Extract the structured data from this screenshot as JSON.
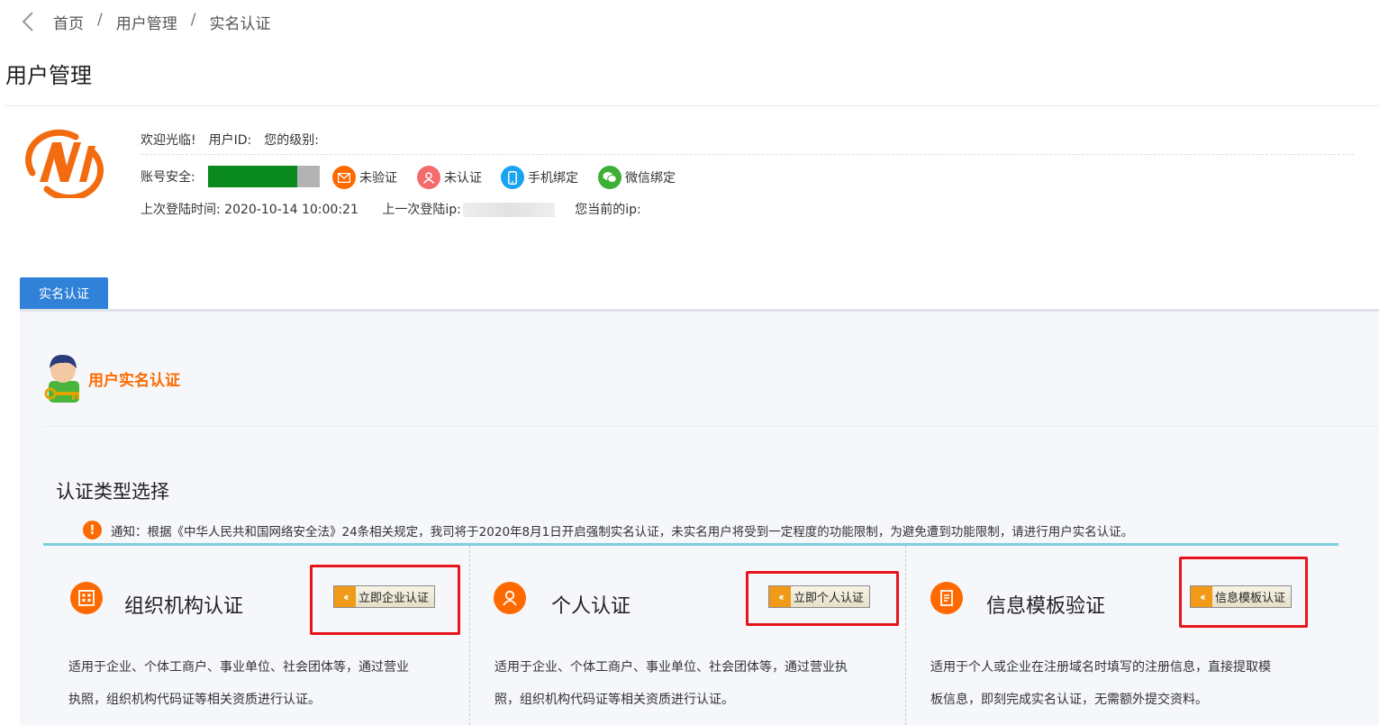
{
  "breadcrumb": [
    "首页",
    "用户管理",
    "实名认证"
  ],
  "page_title": "用户管理",
  "user": {
    "welcome": "欢迎光临!",
    "user_id_label": "用户ID:",
    "level_label": "您的级别:",
    "security_label": "账号安全:",
    "security_progress": 0.8,
    "badges": [
      {
        "icon": "mail-icon",
        "label": "未验证",
        "color": "#ff6a00"
      },
      {
        "icon": "user-icon",
        "label": "未认证",
        "color": "#f36b6b"
      },
      {
        "icon": "phone-icon",
        "label": "手机绑定",
        "color": "#1aa3f0"
      },
      {
        "icon": "wechat-icon",
        "label": "微信绑定",
        "color": "#3cb034"
      }
    ],
    "last_login_label": "上次登陆时间:",
    "last_login_time": "2020-10-14 10:00:21",
    "last_ip_label": "上一次登陆ip:",
    "current_ip_label": "您当前的ip:"
  },
  "tabs": [
    "实名认证"
  ],
  "section": {
    "title": "用户实名认证",
    "type_title": "认证类型选择",
    "notice": "通知：根据《中华人民共和国网络安全法》24条相关规定，我司将于2020年8月1日开启强制实名认证，未实名用户将受到一定程度的功能限制，为避免遭到功能限制，请进行用户实名认证。"
  },
  "cards": [
    {
      "icon": "building-icon",
      "title": "组织机构认证",
      "button": "立即企业认证",
      "desc1": "适用于企业、个体工商户、事业单位、社会团体等，通过营业",
      "desc2": "执照，组织机构代码证等相关资质进行认证。"
    },
    {
      "icon": "person-icon",
      "title": "个人认证",
      "button": "立即个人认证",
      "desc1": "适用于企业、个体工商户、事业单位、社会团体等，通过营业执",
      "desc2": "照，组织机构代码证等相关资质进行认证。"
    },
    {
      "icon": "document-icon",
      "title": "信息模板验证",
      "button": "信息模板认证",
      "desc1": "适用于个人或企业在注册域名时填写的注册信息，直接提取模",
      "desc2": "板信息，即刻完成实名认证，无需额外提交资料。"
    }
  ]
}
